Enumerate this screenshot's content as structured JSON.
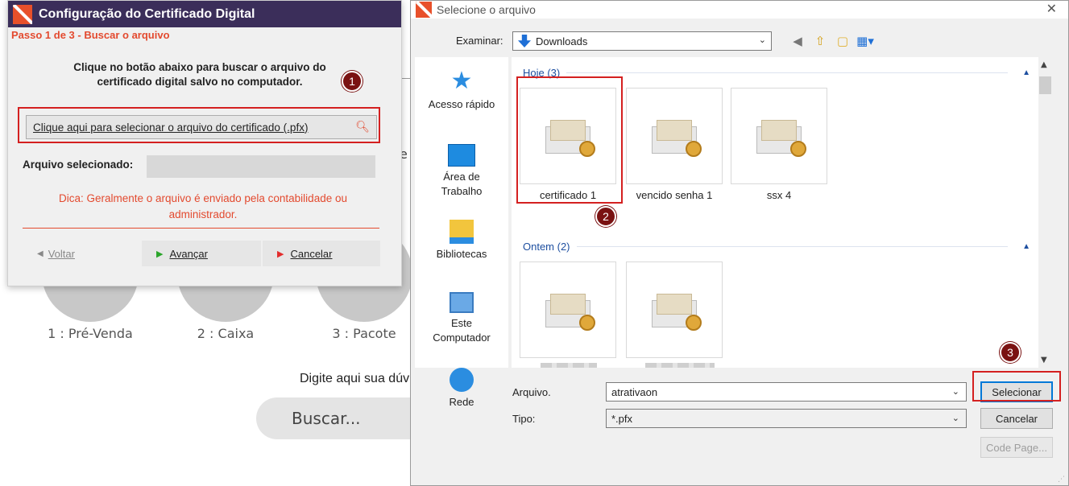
{
  "background": {
    "items": [
      "1 : Pré-Venda",
      "2 : Caixa",
      "3 : Pacote"
    ],
    "question": "Digite aqui sua dúv",
    "search_placeholder": "Buscar...",
    "stray_letter": "e"
  },
  "cert_window": {
    "title": "Configuração do Certificado Digital",
    "step": "Passo 1 de 3 - Buscar o arquivo",
    "instruction": "Clique no botão abaixo para buscar o arquivo do certificado digital salvo no computador.",
    "pick_button": "Clique aqui para selecionar o arquivo do certificado (.pfx)",
    "selected_label": "Arquivo selecionado:",
    "selected_value": "",
    "tip": "Dica: Geralmente o arquivo é enviado pela contabilidade ou administrador.",
    "back_label": "Voltar",
    "next_label": "Avançar",
    "cancel_label": "Cancelar"
  },
  "file_dialog": {
    "title": "Selecione o arquivo",
    "look_in_label": "Examinar:",
    "look_in_value": "Downloads",
    "places": [
      "Acesso rápido",
      "Área de Trabalho",
      "Bibliotecas",
      "Este Computador",
      "Rede"
    ],
    "groups": [
      {
        "title": "Hoje (3)",
        "files": [
          "certificado 1",
          "vencido senha 1",
          "ssx 4"
        ]
      },
      {
        "title": "Ontem (2)",
        "files": [
          "",
          ""
        ]
      }
    ],
    "filename_label": "Arquivo.",
    "filename_value": "atrativaon",
    "type_label": "Tipo:",
    "type_value": "*.pfx",
    "select_button": "Selecionar",
    "cancel_button": "Cancelar",
    "codepage_button": "Code Page..."
  },
  "callouts": [
    "1",
    "2",
    "3"
  ],
  "colors": {
    "title_bar": "#3b2e5a",
    "accent_red": "#e34a2f",
    "callout": "#7a1212",
    "group_blue": "#1e4fa0"
  }
}
